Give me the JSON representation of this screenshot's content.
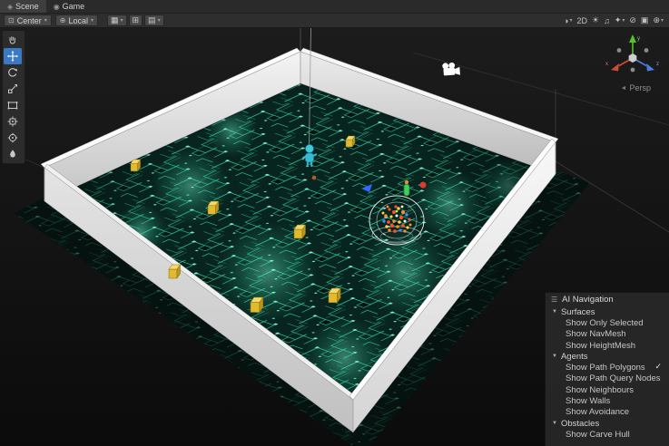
{
  "tabs": {
    "scene": {
      "icon": "◈",
      "label": "Scene"
    },
    "game": {
      "icon": "◉",
      "label": "Game"
    }
  },
  "toolbar": {
    "pivot": {
      "icon": "⊡",
      "label": "Center",
      "caret": "▾"
    },
    "orientation": {
      "icon": "⊕",
      "label": "Local",
      "caret": "▾"
    },
    "snap": [
      {
        "name": "grid-visibility",
        "glyph": "▦",
        "caret": "▾"
      },
      {
        "name": "snap-increment",
        "glyph": "⊞",
        "caret": ""
      },
      {
        "name": "snap-settings",
        "glyph": "▤",
        "caret": "▾"
      }
    ],
    "right": [
      {
        "name": "shading-mode",
        "glyph": "◑",
        "caret": "▾"
      },
      {
        "name": "view-2d",
        "glyph": "2D",
        "caret": ""
      },
      {
        "name": "scene-lighting",
        "glyph": "☀",
        "caret": ""
      },
      {
        "name": "scene-audio",
        "glyph": "♫",
        "caret": ""
      },
      {
        "name": "scene-effects",
        "glyph": "✦",
        "caret": "▾"
      },
      {
        "name": "hidden-objects",
        "glyph": "⊘",
        "caret": ""
      },
      {
        "name": "camera-settings",
        "glyph": "▣",
        "caret": ""
      },
      {
        "name": "gizmos-menu",
        "glyph": "⊕",
        "caret": "▾"
      }
    ]
  },
  "tools": {
    "items": [
      "view-tool",
      "move-tool",
      "rotate-tool",
      "scale-tool",
      "rect-tool",
      "transform-tool",
      "custom-tool",
      "editor-tool"
    ],
    "active": "move-tool"
  },
  "gizmo": {
    "axis_x": "x",
    "axis_y": "y",
    "axis_z": "z",
    "persp_arrow": "◄",
    "persp_label": "Persp"
  },
  "overlay": {
    "title": "AI Navigation",
    "menu_icon": "☰",
    "collapse_glyph": "▼",
    "check_glyph": "✓",
    "sections": [
      {
        "label": "Surfaces",
        "items": [
          {
            "label": "Show Only Selected",
            "checked": false
          },
          {
            "label": "Show NavMesh",
            "checked": false
          },
          {
            "label": "Show HeightMesh",
            "checked": false
          }
        ]
      },
      {
        "label": "Agents",
        "items": [
          {
            "label": "Show Path Polygons",
            "checked": true
          },
          {
            "label": "Show Path Query Nodes",
            "checked": false
          },
          {
            "label": "Show Neighbours",
            "checked": false
          },
          {
            "label": "Show Walls",
            "checked": false
          },
          {
            "label": "Show Avoidance",
            "checked": false
          }
        ]
      },
      {
        "label": "Obstacles",
        "items": [
          {
            "label": "Show Carve Hull",
            "checked": false
          }
        ]
      }
    ]
  },
  "colors": {
    "accent_blue": "#3b79c4",
    "circuit_teal": "#2ec79a",
    "wall_white": "#ededed",
    "obstacle_yellow": "#e0ba2f",
    "agent_green": "#3ecf5e",
    "bot_cyan": "#41c9db"
  }
}
